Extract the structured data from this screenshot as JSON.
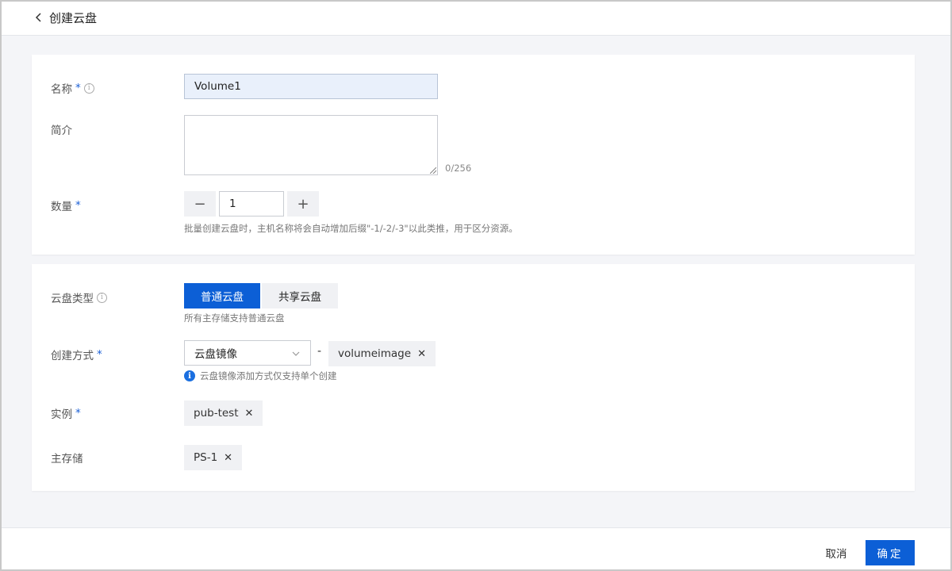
{
  "header": {
    "title": "创建云盘",
    "back_icon": "chevron-left-icon"
  },
  "basic": {
    "name_label": "名称",
    "name_value": "Volume1",
    "desc_label": "简介",
    "desc_value": "",
    "desc_counter": "0/256",
    "qty_label": "数量",
    "qty_value": "1",
    "qty_minus": "−",
    "qty_plus": "+",
    "qty_hint": "批量创建云盘时，主机名称将会自动增加后缀\"-1/-2/-3\"以此类推，用于区分资源。",
    "required_mark": "*"
  },
  "config": {
    "type_label": "云盘类型",
    "type_options": [
      "普通云盘",
      "共享云盘"
    ],
    "type_selected": "普通云盘",
    "type_hint": "所有主存储支持普通云盘",
    "method_label": "创建方式",
    "method_value": "云盘镜像",
    "method_dash": "-",
    "method_tag": "volumeimage",
    "method_note": "云盘镜像添加方式仅支持单个创建",
    "instance_label": "实例",
    "instance_tag": "pub-test",
    "storage_label": "主存储",
    "storage_tag": "PS-1"
  },
  "footer": {
    "cancel_label": "取消",
    "ok_label": "确定"
  },
  "colors": {
    "primary": "#0c5fd6",
    "required": "#1a5fd6",
    "info": "#1a6fe0"
  }
}
